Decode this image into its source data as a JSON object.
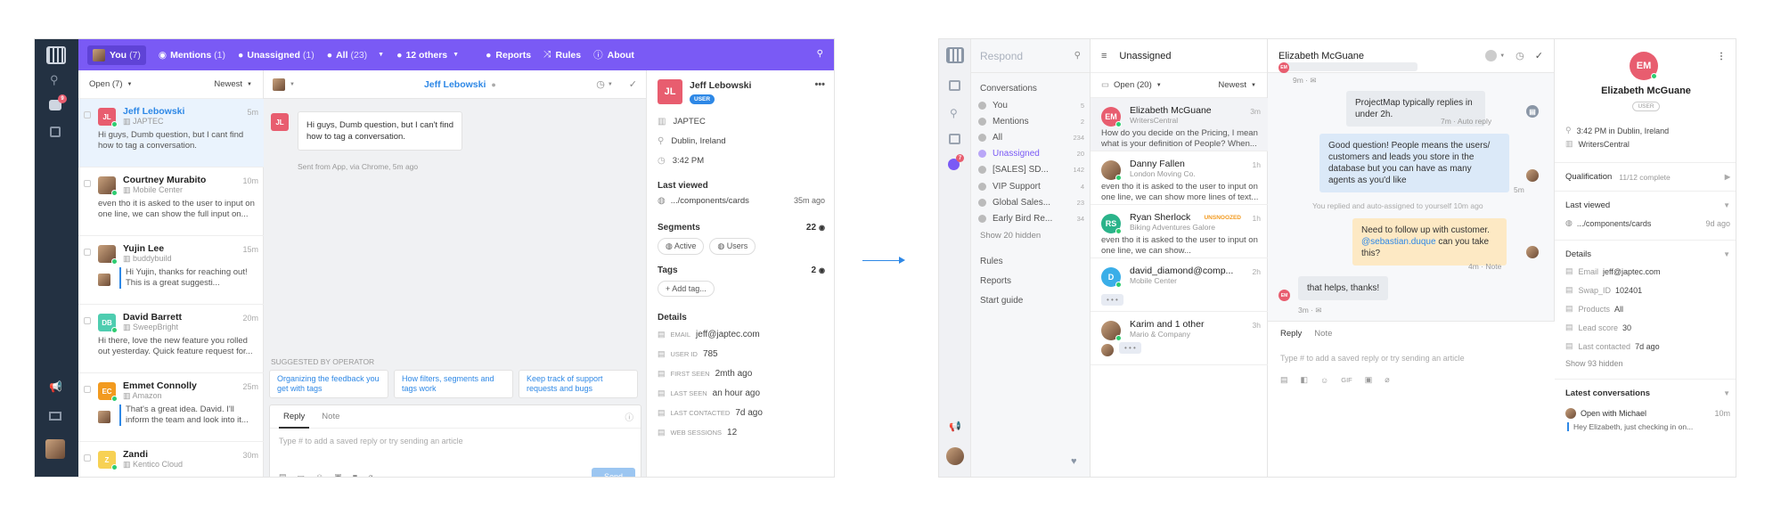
{
  "left": {
    "topbar": {
      "you": "You",
      "you_count": "(7)",
      "mentions": "Mentions",
      "mentions_count": "(1)",
      "unassigned": "Unassigned",
      "unassigned_count": "(1)",
      "all": "All",
      "all_count": "(23)",
      "others": "12 others",
      "reports": "Reports",
      "rules": "Rules",
      "about": "About"
    },
    "list": {
      "filter": "Open (7)",
      "sort": "Newest",
      "items": [
        {
          "initials": "JL",
          "name": "Jeff Lebowski",
          "org": "JAPTEC",
          "time": "5m",
          "snippet": "Hi guys, Dumb question, but I cant find how to tag a conversation.",
          "color": "#e85d6f"
        },
        {
          "initials": "",
          "name": "Courtney Murabito",
          "org": "Mobile Center",
          "time": "10m",
          "snippet": "even tho it is asked to the user to input on one line, we can show the full input on...",
          "color": ""
        },
        {
          "initials": "",
          "name": "Yujin Lee",
          "org": "buddybuild",
          "time": "15m",
          "snippet": "Hi Yujin, thanks for reaching out! This is a great suggesti...",
          "color": ""
        },
        {
          "initials": "DB",
          "name": "David Barrett",
          "org": "SweepBright",
          "time": "20m",
          "snippet": "Hi there, love the new feature you rolled out yesterday. Quick feature request for...",
          "color": "#4ecdb0"
        },
        {
          "initials": "EC",
          "name": "Emmet Connolly",
          "org": "Amazon",
          "time": "25m",
          "snippet": "That's a great idea. David. I'll inform the team and look into it...",
          "color": "#f29a1f"
        },
        {
          "initials": "Z",
          "name": "Zandi",
          "org": "Kentico Cloud",
          "time": "30m",
          "snippet": "",
          "color": "#f7d154"
        }
      ]
    },
    "conv": {
      "title": "Jeff Lebowski",
      "message": "Hi guys, Dumb question, but I can't find how to tag a conversation.",
      "meta": "Sent from App, via Chrome, 5m ago",
      "suggested_label": "SUGGESTED BY OPERATOR",
      "suggestions": [
        "Organizing the feedback you get with tags",
        "How filters, segments and tags work",
        "Keep track of support requests and bugs"
      ],
      "tab_reply": "Reply",
      "tab_note": "Note",
      "placeholder": "Type # to add a saved reply or try sending an article",
      "send": "Send"
    },
    "side": {
      "initials": "JL",
      "name": "Jeff Lebowski",
      "badge": "USER",
      "company": "JAPTEC",
      "location": "Dublin, Ireland",
      "time": "3:42 PM",
      "last_viewed_label": "Last viewed",
      "last_viewed_path": ".../components/cards",
      "last_viewed_time": "35m ago",
      "segments_label": "Segments",
      "segments_count": "22",
      "segments": [
        "Active",
        "Users"
      ],
      "tags_label": "Tags",
      "tags_count": "2",
      "add_tag": "+ Add tag...",
      "details_label": "Details",
      "details": [
        {
          "k": "EMAIL",
          "v": "jeff@japtec.com"
        },
        {
          "k": "USER ID",
          "v": "785"
        },
        {
          "k": "FIRST SEEN",
          "v": "2mth ago"
        },
        {
          "k": "LAST SEEN",
          "v": "an hour ago"
        },
        {
          "k": "LAST CONTACTED",
          "v": "7d ago"
        },
        {
          "k": "WEB SESSIONS",
          "v": "12"
        }
      ]
    }
  },
  "right": {
    "nav": {
      "search_placeholder": "Respond",
      "section": "Conversations",
      "items": [
        {
          "label": "You",
          "n": "5"
        },
        {
          "label": "Mentions",
          "n": "2"
        },
        {
          "label": "All",
          "n": "234"
        },
        {
          "label": "Unassigned",
          "n": "20"
        },
        {
          "label": "[SALES] SD...",
          "n": "142"
        },
        {
          "label": "VIP Support",
          "n": "4"
        },
        {
          "label": "Global Sales...",
          "n": "23"
        },
        {
          "label": "Early Bird Re...",
          "n": "34"
        }
      ],
      "show_hidden": "Show 20 hidden",
      "rules": "Rules",
      "reports": "Reports",
      "start": "Start guide"
    },
    "inbox": {
      "title": "Unassigned",
      "filter": "Open (20)",
      "sort": "Newest",
      "items": [
        {
          "initials": "EM",
          "name": "Elizabeth McGuane",
          "org": "WritersCentral",
          "time": "3m",
          "snippet": "How do you decide on the Pricing, I mean what is your definition of People? When...",
          "color": "#e85d6f"
        },
        {
          "initials": "",
          "name": "Danny Fallen",
          "org": "London Moving Co.",
          "time": "1h",
          "snippet": "even tho it is asked to the user to input on one line, we can show more lines of text...",
          "color": ""
        },
        {
          "initials": "RS",
          "name": "Ryan Sherlock",
          "org": "Biking Adventures Galore",
          "time": "1h",
          "unsnoozed": "UNSNOOZED",
          "snippet": "even tho it is asked to the user to input on one line, we can show...",
          "color": "#2bb38a"
        },
        {
          "initials": "D",
          "name": "david_diamond@comp...",
          "org": "Mobile Center",
          "time": "2h",
          "snippet": "• • •",
          "color": "#3aaee8"
        },
        {
          "initials": "",
          "name": "Karim and 1 other",
          "org": "Mario & Company",
          "time": "3h",
          "snippet": "• • •",
          "color": ""
        }
      ]
    },
    "chat": {
      "title": "Elizabeth McGuane",
      "time1": "9m · ✉",
      "bubble1": "ProjectMap typically replies in under 2h.",
      "meta1": "7m · Auto reply",
      "bubble2": "Good question! People means the users/ customers and leads you store in the database but you can have as many agents as you'd like",
      "time2": "5m",
      "sys": "You replied and auto-assigned to yourself 10m ago",
      "bubble3a": "Need to follow up with customer.",
      "bubble3b": "@sebastian.duque",
      "bubble3c": " can you take this?",
      "meta3": "4m · Note",
      "bubble4": "that helps, thanks!",
      "time4": "3m · ✉",
      "tab_reply": "Reply",
      "tab_note": "Note",
      "placeholder": "Type # to add a saved reply or try sending an article"
    },
    "profile": {
      "initials": "EM",
      "name": "Elizabeth McGuane",
      "badge": "USER",
      "time_location": "3:42 PM in Dublin, Ireland",
      "company": "WritersCentral",
      "qualification_label": "Qualification",
      "qualification_val": "11/12 complete",
      "last_viewed_label": "Last viewed",
      "last_viewed_path": ".../components/cards",
      "last_viewed_time": "9d ago",
      "details_label": "Details",
      "details": [
        {
          "k": "Email",
          "v": "jeff@japtec.com"
        },
        {
          "k": "Swap_ID",
          "v": "102401"
        },
        {
          "k": "Products",
          "v": "All"
        },
        {
          "k": "Lead score",
          "v": "30"
        },
        {
          "k": "Last contacted",
          "v": "7d ago"
        }
      ],
      "show_hidden": "Show 93 hidden",
      "latest_label": "Latest conversations",
      "latest_title": "Open with Michael",
      "latest_time": "10m",
      "latest_snippet": "Hey Elizabeth, just checking in on..."
    }
  },
  "colors": {
    "purple": "#7a5af5",
    "blue": "#2e88e6",
    "red": "#e85d6f"
  }
}
